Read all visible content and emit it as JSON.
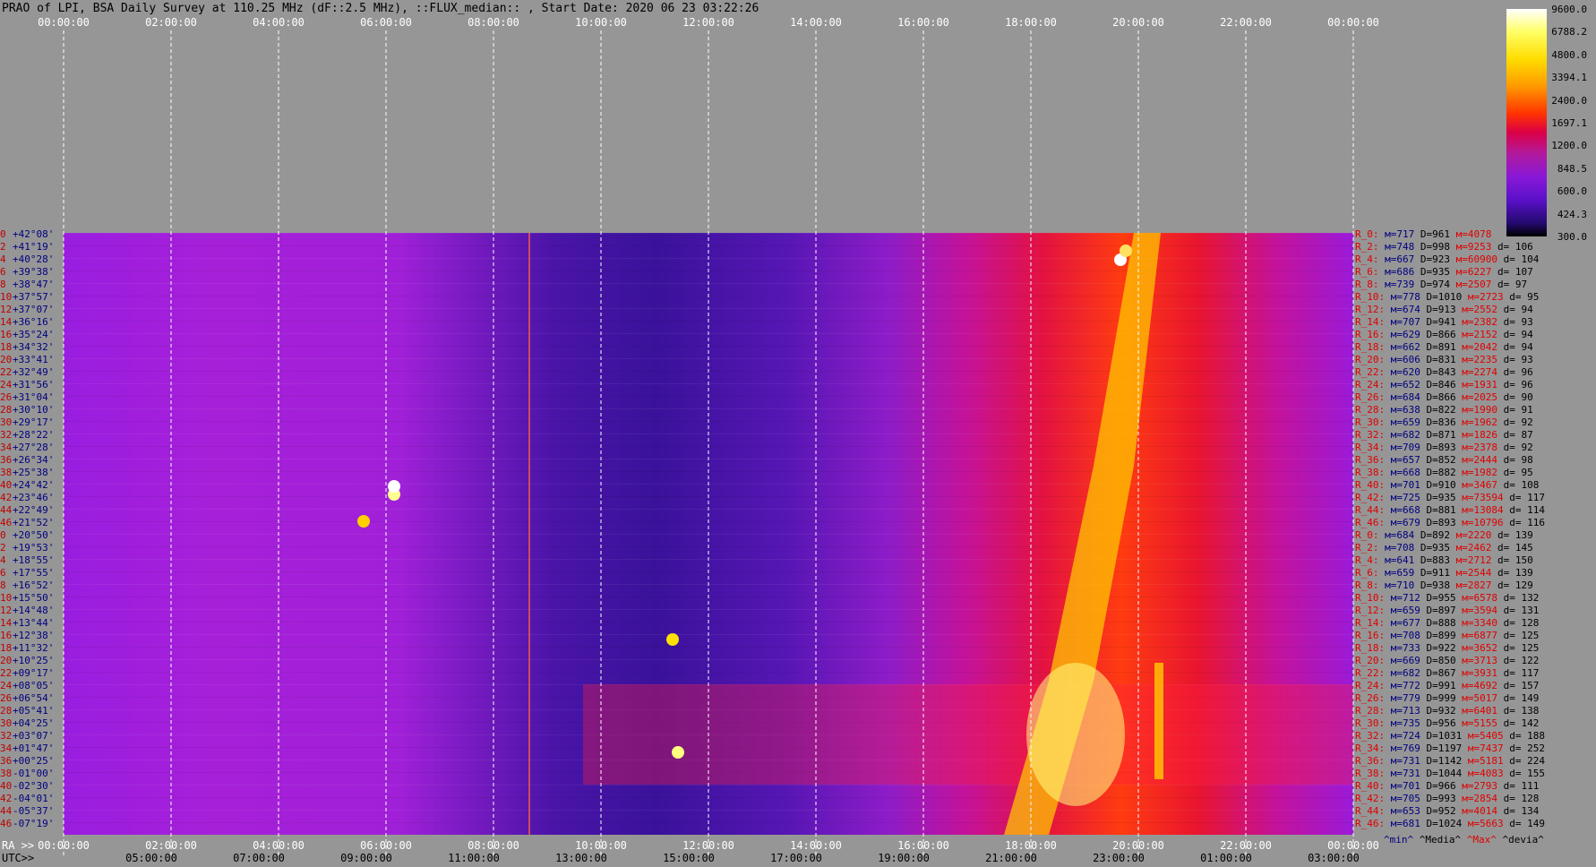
{
  "title": "PRAO of LPI, BSA Daily Survey at 110.25 MHz (dF::2.5 MHz), ::FLUX_median:: , Start Date: 2020 06 23 03:22:26",
  "top_axis": [
    "00:00:00",
    "02:00:00",
    "04:00:00",
    "06:00:00",
    "08:00:00",
    "10:00:00",
    "12:00:00",
    "14:00:00",
    "16:00:00",
    "18:00:00",
    "20:00:00",
    "22:00:00",
    "00:00:00"
  ],
  "ra_axis": {
    "label": "RA >>",
    "ticks": [
      "00:00:00",
      "02:00:00",
      "04:00:00",
      "06:00:00",
      "08:00:00",
      "10:00:00",
      "12:00:00",
      "14:00:00",
      "16:00:00",
      "18:00:00",
      "20:00:00",
      "22:00:00",
      "00:00:00"
    ]
  },
  "utc_axis": {
    "label": "UTC>>",
    "ticks": [
      "05:00:00",
      "07:00:00",
      "09:00:00",
      "11:00:00",
      "13:00:00",
      "15:00:00",
      "17:00:00",
      "19:00:00",
      "21:00:00",
      "23:00:00",
      "01:00:00",
      "03:00:00"
    ]
  },
  "colorbar": [
    "9600.0",
    "6788.2",
    "4800.0",
    "3394.1",
    "2400.0",
    "1697.1",
    "1200.0",
    "848.5",
    "600.0",
    "424.3",
    "300.0"
  ],
  "declinations": [
    {
      "i": "0",
      "d": "+42°08'"
    },
    {
      "i": "2",
      "d": "+41°19'"
    },
    {
      "i": "4",
      "d": "+40°28'"
    },
    {
      "i": "6",
      "d": "+39°38'"
    },
    {
      "i": "8",
      "d": "+38°47'"
    },
    {
      "i": "10",
      "d": "+37°57'"
    },
    {
      "i": "12",
      "d": "+37°07'"
    },
    {
      "i": "14",
      "d": "+36°16'"
    },
    {
      "i": "16",
      "d": "+35°24'"
    },
    {
      "i": "18",
      "d": "+34°32'"
    },
    {
      "i": "20",
      "d": "+33°41'"
    },
    {
      "i": "22",
      "d": "+32°49'"
    },
    {
      "i": "24",
      "d": "+31°56'"
    },
    {
      "i": "26",
      "d": "+31°04'"
    },
    {
      "i": "28",
      "d": "+30°10'"
    },
    {
      "i": "30",
      "d": "+29°17'"
    },
    {
      "i": "32",
      "d": "+28°22'"
    },
    {
      "i": "34",
      "d": "+27°28'"
    },
    {
      "i": "36",
      "d": "+26°34'"
    },
    {
      "i": "38",
      "d": "+25°38'"
    },
    {
      "i": "40",
      "d": "+24°42'"
    },
    {
      "i": "42",
      "d": "+23°46'"
    },
    {
      "i": "44",
      "d": "+22°49'"
    },
    {
      "i": "46",
      "d": "+21°52'"
    },
    {
      "i": "0",
      "d": "+20°50'"
    },
    {
      "i": "2",
      "d": "+19°53'"
    },
    {
      "i": "4",
      "d": "+18°55'"
    },
    {
      "i": "6",
      "d": "+17°55'"
    },
    {
      "i": "8",
      "d": "+16°52'"
    },
    {
      "i": "10",
      "d": "+15°50'"
    },
    {
      "i": "12",
      "d": "+14°48'"
    },
    {
      "i": "14",
      "d": "+13°44'"
    },
    {
      "i": "16",
      "d": "+12°38'"
    },
    {
      "i": "18",
      "d": "+11°32'"
    },
    {
      "i": "20",
      "d": "+10°25'"
    },
    {
      "i": "22",
      "d": "+09°17'"
    },
    {
      "i": "24",
      "d": "+08°05'"
    },
    {
      "i": "26",
      "d": "+06°54'"
    },
    {
      "i": "28",
      "d": "+05°41'"
    },
    {
      "i": "30",
      "d": "+04°25'"
    },
    {
      "i": "32",
      "d": "+03°07'"
    },
    {
      "i": "34",
      "d": "+01°47'"
    },
    {
      "i": "36",
      "d": "+00°25'"
    },
    {
      "i": "38",
      "d": "-01°00'"
    },
    {
      "i": "40",
      "d": "-02°30'"
    },
    {
      "i": "42",
      "d": "-04°01'"
    },
    {
      "i": "44",
      "d": "-05°37'"
    },
    {
      "i": "46",
      "d": "-07°19'"
    }
  ],
  "stats": [
    {
      "r": "R_0:",
      "m": "м=717",
      "d": "D=961",
      "h": "м=4078",
      "dv": ""
    },
    {
      "r": "R_2:",
      "m": "м=748",
      "d": "D=998",
      "h": "м=9253",
      "dv": "d= 106"
    },
    {
      "r": "R_4:",
      "m": "м=667",
      "d": "D=923",
      "h": "м=60900",
      "dv": "d= 104"
    },
    {
      "r": "R_6:",
      "m": "м=686",
      "d": "D=935",
      "h": "м=6227",
      "dv": "d= 107"
    },
    {
      "r": "R_8:",
      "m": "м=739",
      "d": "D=974",
      "h": "м=2507",
      "dv": "d= 97"
    },
    {
      "r": "R_10:",
      "m": "м=778",
      "d": "D=1010",
      "h": "м=2723",
      "dv": "d= 95"
    },
    {
      "r": "R_12:",
      "m": "м=674",
      "d": "D=913",
      "h": "м=2552",
      "dv": "d= 94"
    },
    {
      "r": "R_14:",
      "m": "м=707",
      "d": "D=941",
      "h": "м=2382",
      "dv": "d= 93"
    },
    {
      "r": "R_16:",
      "m": "м=629",
      "d": "D=866",
      "h": "м=2152",
      "dv": "d= 94"
    },
    {
      "r": "R_18:",
      "m": "м=662",
      "d": "D=891",
      "h": "м=2042",
      "dv": "d= 94"
    },
    {
      "r": "R_20:",
      "m": "м=606",
      "d": "D=831",
      "h": "м=2235",
      "dv": "d= 93"
    },
    {
      "r": "R_22:",
      "m": "м=620",
      "d": "D=843",
      "h": "м=2274",
      "dv": "d= 96"
    },
    {
      "r": "R_24:",
      "m": "м=652",
      "d": "D=846",
      "h": "м=1931",
      "dv": "d= 96"
    },
    {
      "r": "R_26:",
      "m": "м=684",
      "d": "D=866",
      "h": "м=2025",
      "dv": "d= 90"
    },
    {
      "r": "R_28:",
      "m": "м=638",
      "d": "D=822",
      "h": "м=1990",
      "dv": "d= 91"
    },
    {
      "r": "R_30:",
      "m": "м=659",
      "d": "D=836",
      "h": "м=1962",
      "dv": "d= 92"
    },
    {
      "r": "R_32:",
      "m": "м=682",
      "d": "D=871",
      "h": "м=1826",
      "dv": "d= 87"
    },
    {
      "r": "R_34:",
      "m": "м=709",
      "d": "D=893",
      "h": "м=2378",
      "dv": "d= 92"
    },
    {
      "r": "R_36:",
      "m": "м=657",
      "d": "D=852",
      "h": "м=2444",
      "dv": "d= 98"
    },
    {
      "r": "R_38:",
      "m": "м=668",
      "d": "D=882",
      "h": "м=1982",
      "dv": "d= 95"
    },
    {
      "r": "R_40:",
      "m": "м=701",
      "d": "D=910",
      "h": "м=3467",
      "dv": "d= 108"
    },
    {
      "r": "R_42:",
      "m": "м=725",
      "d": "D=935",
      "h": "м=73594",
      "dv": "d= 117"
    },
    {
      "r": "R_44:",
      "m": "м=668",
      "d": "D=881",
      "h": "м=13084",
      "dv": "d= 114"
    },
    {
      "r": "R_46:",
      "m": "м=679",
      "d": "D=893",
      "h": "м=10796",
      "dv": "d= 116"
    },
    {
      "r": "R_0:",
      "m": "м=684",
      "d": "D=892",
      "h": "м=2220",
      "dv": "d= 139"
    },
    {
      "r": "R_2:",
      "m": "м=708",
      "d": "D=935",
      "h": "м=2462",
      "dv": "d= 145"
    },
    {
      "r": "R_4:",
      "m": "м=641",
      "d": "D=883",
      "h": "м=2712",
      "dv": "d= 150"
    },
    {
      "r": "R_6:",
      "m": "м=659",
      "d": "D=911",
      "h": "м=2544",
      "dv": "d= 139"
    },
    {
      "r": "R_8:",
      "m": "м=710",
      "d": "D=938",
      "h": "м=2827",
      "dv": "d= 129"
    },
    {
      "r": "R_10:",
      "m": "м=712",
      "d": "D=955",
      "h": "м=6578",
      "dv": "d= 132"
    },
    {
      "r": "R_12:",
      "m": "м=659",
      "d": "D=897",
      "h": "м=3594",
      "dv": "d= 131"
    },
    {
      "r": "R_14:",
      "m": "м=677",
      "d": "D=888",
      "h": "м=3340",
      "dv": "d= 128"
    },
    {
      "r": "R_16:",
      "m": "м=708",
      "d": "D=899",
      "h": "м=6877",
      "dv": "d= 125"
    },
    {
      "r": "R_18:",
      "m": "м=733",
      "d": "D=922",
      "h": "м=3652",
      "dv": "d= 125"
    },
    {
      "r": "R_20:",
      "m": "м=669",
      "d": "D=850",
      "h": "м=3713",
      "dv": "d= 122"
    },
    {
      "r": "R_22:",
      "m": "м=682",
      "d": "D=867",
      "h": "м=3931",
      "dv": "d= 117"
    },
    {
      "r": "R_24:",
      "m": "м=772",
      "d": "D=991",
      "h": "м=4692",
      "dv": "d= 157"
    },
    {
      "r": "R_26:",
      "m": "м=779",
      "d": "D=999",
      "h": "м=5017",
      "dv": "d= 149"
    },
    {
      "r": "R_28:",
      "m": "м=713",
      "d": "D=932",
      "h": "м=6401",
      "dv": "d= 138"
    },
    {
      "r": "R_30:",
      "m": "м=735",
      "d": "D=956",
      "h": "м=5155",
      "dv": "d= 142"
    },
    {
      "r": "R_32:",
      "m": "м=724",
      "d": "D=1031",
      "h": "м=5405",
      "dv": "d= 188"
    },
    {
      "r": "R_34:",
      "m": "м=769",
      "d": "D=1197",
      "h": "м=7437",
      "dv": "d= 252"
    },
    {
      "r": "R_36:",
      "m": "м=731",
      "d": "D=1142",
      "h": "м=5181",
      "dv": "d= 224"
    },
    {
      "r": "R_38:",
      "m": "м=731",
      "d": "D=1044",
      "h": "м=4083",
      "dv": "d= 155"
    },
    {
      "r": "R_40:",
      "m": "м=701",
      "d": "D=966",
      "h": "м=2793",
      "dv": "d= 111"
    },
    {
      "r": "R_42:",
      "m": "м=705",
      "d": "D=993",
      "h": "м=2854",
      "dv": "d= 128"
    },
    {
      "r": "R_44:",
      "m": "м=653",
      "d": "D=952",
      "h": "м=4014",
      "dv": "d= 134"
    },
    {
      "r": "R_46:",
      "m": "м=681",
      "d": "D=1024",
      "h": "м=5663",
      "dv": "d= 149"
    }
  ],
  "stats_legend": {
    "min": "^min^",
    "median": "^Media^",
    "max": "^Max^",
    "dev": "^devia^"
  }
}
